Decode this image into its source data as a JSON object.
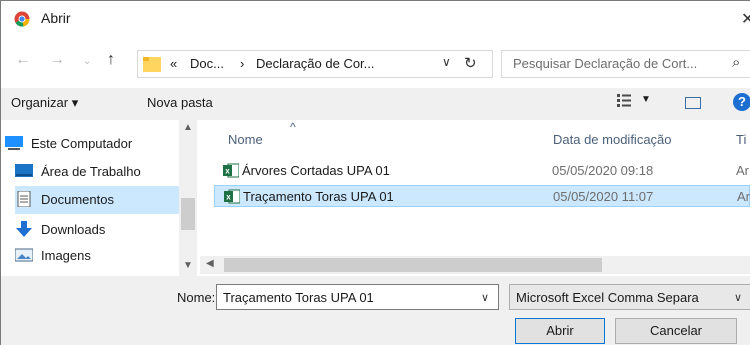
{
  "window": {
    "title": "Abrir",
    "icon": "chrome-icon"
  },
  "address": {
    "crumbs": [
      "«",
      "Doc...",
      "›",
      "Declaração de Cor..."
    ],
    "search_placeholder": "Pesquisar Declaração de Cort..."
  },
  "toolbar": {
    "organize_label": "Organizar ▾",
    "new_folder_label": "Nova pasta"
  },
  "nav": {
    "items": [
      {
        "label": "Este Computador",
        "icon": "computer-icon"
      },
      {
        "label": "Área de Trabalho",
        "icon": "desktop-icon"
      },
      {
        "label": "Documentos",
        "icon": "documents-icon",
        "selected": true
      },
      {
        "label": "Downloads",
        "icon": "downloads-icon"
      },
      {
        "label": "Imagens",
        "icon": "pictures-icon"
      }
    ]
  },
  "files": {
    "columns": {
      "name": "Nome",
      "modified": "Data de modificação",
      "type": "Ti"
    },
    "rows": [
      {
        "name": "Árvores Cortadas UPA 01",
        "modified": "05/05/2020 09:18",
        "type": "Ar",
        "icon": "excel-csv-icon",
        "selected": false
      },
      {
        "name": "Traçamento Toras UPA 01",
        "modified": "05/05/2020 11:07",
        "type": "Ar",
        "icon": "excel-csv-icon",
        "selected": true
      }
    ]
  },
  "footer": {
    "filename_label": "Nome:",
    "filename_value": "Traçamento Toras UPA 01",
    "filetype_value": "Microsoft Excel Comma Separa",
    "open_label": "Abrir",
    "cancel_label": "Cancelar"
  },
  "colors": {
    "selection": "#cce8ff",
    "accent": "#0078d7",
    "excel_green": "#1e7145"
  }
}
